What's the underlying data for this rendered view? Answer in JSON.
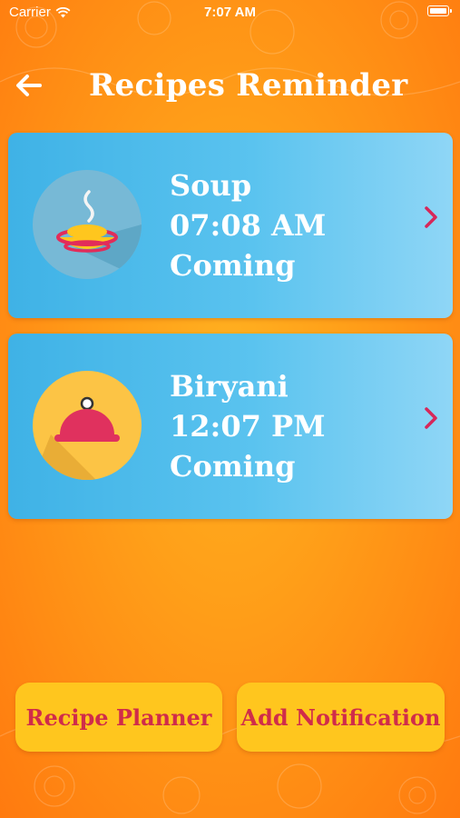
{
  "status_bar": {
    "carrier": "Carrier",
    "time": "7:07 AM",
    "wifi_icon": "wifi-icon",
    "battery_icon": "battery-icon"
  },
  "header": {
    "title": "Recipes Reminder",
    "back_icon": "back-arrow-icon"
  },
  "reminders": [
    {
      "name": "Soup",
      "time": "07:08 AM",
      "status": "Coming",
      "icon": "soup-bowl-icon"
    },
    {
      "name": "Biryani",
      "time": "12:07 PM",
      "status": "Coming",
      "icon": "food-cloche-icon"
    }
  ],
  "actions": {
    "planner_label": "Recipe Planner",
    "notification_label": "Add Notification"
  },
  "colors": {
    "background": "#ff9a18",
    "card": "#4fbdec",
    "button": "#ffc61e",
    "button_text": "#d02c4a",
    "chevron": "#d6275a"
  }
}
